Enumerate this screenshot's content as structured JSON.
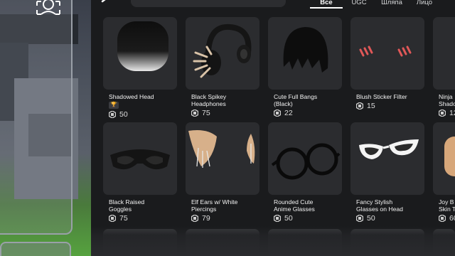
{
  "preview": {
    "face_icon": "face-frame-icon"
  },
  "topbar": {
    "back_icon": "back-arrow-icon",
    "tabs": [
      {
        "label": "Все",
        "active": true
      },
      {
        "label": "UGC",
        "active": false
      },
      {
        "label": "Шляпа",
        "active": false
      },
      {
        "label": "Лицо",
        "active": false
      }
    ]
  },
  "items": [
    {
      "name_line1": "Shadowed Head",
      "name_line2": "[🏆]",
      "price": "50"
    },
    {
      "name_line1": "Black Spikey",
      "name_line2": "Headphones",
      "price": "75"
    },
    {
      "name_line1": "Cute Full Bangs",
      "name_line2": "(Black)",
      "price": "22"
    },
    {
      "name_line1": "Blush Sticker Filter",
      "name_line2": "",
      "price": "15"
    },
    {
      "name_line1": "Ninja",
      "name_line2": "Shado",
      "price": "12"
    },
    {
      "name_line1": "Black Raised",
      "name_line2": "Goggles",
      "price": "75"
    },
    {
      "name_line1": "Elf Ears w/ White",
      "name_line2": "Piercings",
      "price": "79"
    },
    {
      "name_line1": "Rounded Cute",
      "name_line2": "Anime Glasses",
      "price": "50"
    },
    {
      "name_line1": "Fancy Stylish",
      "name_line2": "Glasses on Head",
      "price": "50"
    },
    {
      "name_line1": "Joy B",
      "name_line2": "Skin T",
      "price": "60"
    }
  ],
  "colors": {
    "card_bg": "#2b2c2f",
    "page_bg": "#1a1b1d",
    "ground_green": "#56a23f"
  }
}
